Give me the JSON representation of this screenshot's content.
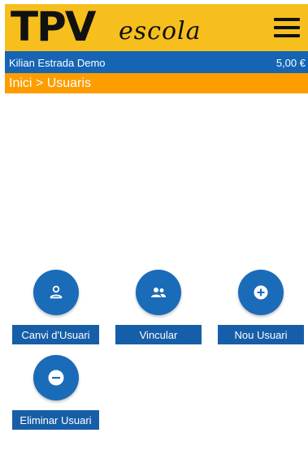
{
  "header": {
    "logo_text": "TPV",
    "logo_script": "escola",
    "menu_icon": "hamburger-menu-icon",
    "background": "#f7bf1d"
  },
  "user_bar": {
    "name": "Kilian Estrada Demo",
    "balance": "5,00 €",
    "background": "#1565b4"
  },
  "breadcrumb": {
    "home": "Inici",
    "separator": ">",
    "current": "Usuaris",
    "background": "#fd9d00"
  },
  "actions": [
    {
      "label": "Canvi d'Usuari",
      "icon": "person-icon"
    },
    {
      "label": "Vincular",
      "icon": "people-icon"
    },
    {
      "label": "Nou Usuari",
      "icon": "plus-circle-icon"
    },
    {
      "label": "Eliminar Usuari",
      "icon": "minus-circle-icon"
    }
  ],
  "accent_color": "#1a6bb8"
}
